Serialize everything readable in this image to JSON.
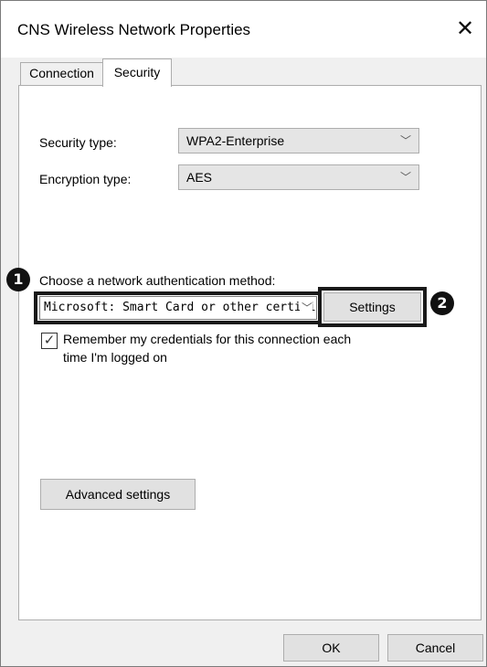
{
  "window": {
    "title": "CNS Wireless Network Properties",
    "close_glyph": "✕"
  },
  "tabs": [
    {
      "label": "Connection",
      "active": false
    },
    {
      "label": "Security",
      "active": true
    }
  ],
  "security": {
    "security_type_label": "Security type:",
    "security_type_value": "WPA2-Enterprise",
    "encryption_type_label": "Encryption type:",
    "encryption_type_value": "AES",
    "auth_method_label": "Choose a network authentication method:",
    "auth_method_value": "Microsoft: Smart Card or other certific",
    "settings_button": "Settings",
    "remember_line1": "Remember my credentials for this connection each",
    "remember_line2": "time I'm logged on",
    "remember_checked": true,
    "advanced_button": "Advanced settings"
  },
  "annotations": {
    "badge1": "1",
    "badge2": "2"
  },
  "footer": {
    "ok_button": "OK",
    "cancel_button": "Cancel"
  },
  "icons": {
    "chevron": "chevron-down-icon",
    "checkmark": "checkmark-icon",
    "close": "close-icon"
  }
}
